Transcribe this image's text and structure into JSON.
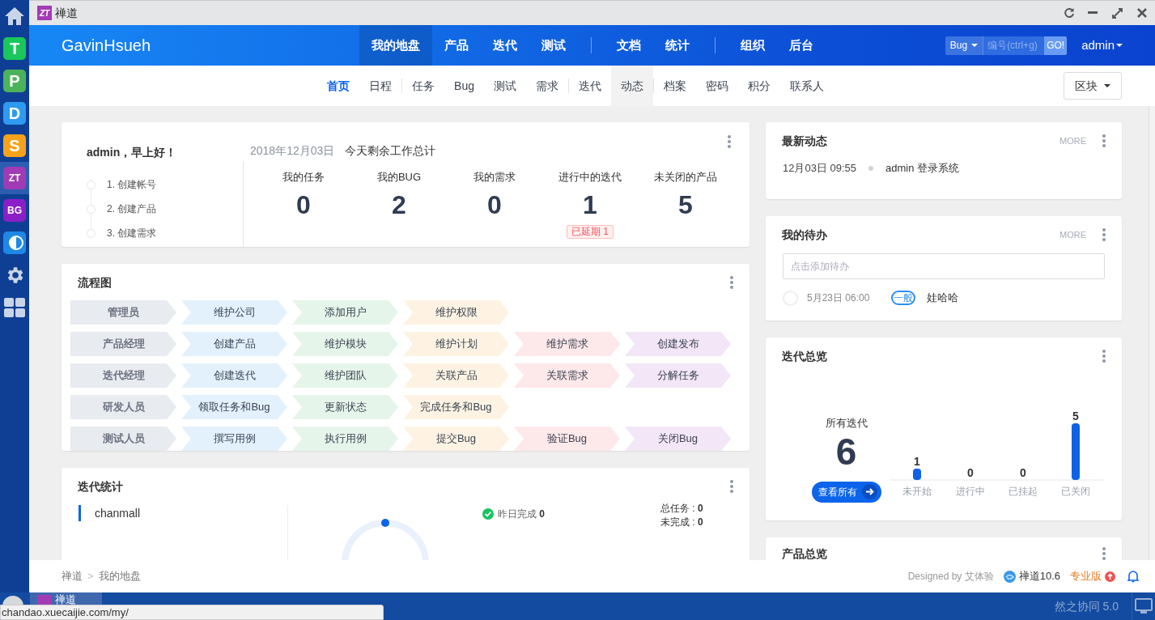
{
  "launcher": {
    "apps": [
      {
        "kind": "home",
        "selected": false
      },
      {
        "kind": "letter",
        "label": "T",
        "color": "#19c75b",
        "selected": false
      },
      {
        "kind": "letter",
        "label": "P",
        "color": "#4cb35a",
        "selected": false
      },
      {
        "kind": "letter",
        "label": "D",
        "color": "#2f9bf0",
        "selected": false
      },
      {
        "kind": "letter",
        "label": "S",
        "color": "#f7a21b",
        "selected": false
      },
      {
        "kind": "letter",
        "label": "ZT",
        "color": "#a03bb5",
        "selected": true
      },
      {
        "kind": "letter",
        "label": "BG",
        "color": "#8a1fc8",
        "selected": false
      },
      {
        "kind": "half-circle",
        "color": "#1e88e5",
        "selected": false
      },
      {
        "kind": "settings",
        "selected": false
      },
      {
        "kind": "grid",
        "selected": false
      }
    ]
  },
  "titlebar": {
    "logo": "ZT",
    "title": "禅道"
  },
  "header": {
    "brand": "GavinHsueh",
    "nav": [
      [
        {
          "label": "我的地盘",
          "selected": true
        },
        {
          "label": "产品",
          "selected": false
        },
        {
          "label": "迭代",
          "selected": false
        },
        {
          "label": "测试",
          "selected": false
        }
      ],
      [
        {
          "label": "文档",
          "selected": false
        },
        {
          "label": "统计",
          "selected": false
        }
      ],
      [
        {
          "label": "组织",
          "selected": false
        },
        {
          "label": "后台",
          "selected": false
        }
      ]
    ],
    "search": {
      "type": "Bug",
      "placeholder": "编号(ctrl+g)",
      "button": "GO!"
    },
    "user": "admin"
  },
  "subnav": {
    "groups": [
      [
        {
          "label": "首页",
          "selected": true,
          "hovered": false
        },
        {
          "label": "日程",
          "selected": false,
          "hovered": false
        }
      ],
      [
        {
          "label": "任务",
          "selected": false,
          "hovered": false
        },
        {
          "label": "Bug",
          "selected": false,
          "hovered": false
        },
        {
          "label": "测试",
          "selected": false,
          "hovered": false
        },
        {
          "label": "需求",
          "selected": false,
          "hovered": false
        }
      ],
      [
        {
          "label": "迭代",
          "selected": false,
          "hovered": false
        },
        {
          "label": "动态",
          "selected": false,
          "hovered": true
        }
      ],
      [
        {
          "label": "档案",
          "selected": false,
          "hovered": false
        },
        {
          "label": "密码",
          "selected": false,
          "hovered": false
        },
        {
          "label": "积分",
          "selected": false,
          "hovered": false
        },
        {
          "label": "联系人",
          "selected": false,
          "hovered": false
        }
      ]
    ],
    "block_button": "区块"
  },
  "welcome": {
    "greeting": "admin，早上好！",
    "steps": [
      "1. 创建帐号",
      "2. 创建产品",
      "3. 创建需求"
    ],
    "date": "2018年12月03日",
    "summary": "今天剩余工作总计",
    "stats": [
      {
        "label": "我的任务",
        "value": "0"
      },
      {
        "label": "我的BUG",
        "value": "2"
      },
      {
        "label": "我的需求",
        "value": "0"
      },
      {
        "label": "进行中的迭代",
        "value": "1",
        "badge": "已延期 1"
      },
      {
        "label": "未关闭的产品",
        "value": "5"
      }
    ]
  },
  "flowchart": {
    "title": "流程图",
    "rows": [
      {
        "role": "管理员",
        "steps": [
          {
            "label": "维护公司",
            "color": "#e3f1fd"
          },
          {
            "label": "添加用户",
            "color": "#e6f5ea"
          },
          {
            "label": "维护权限",
            "color": "#fef3e3"
          }
        ]
      },
      {
        "role": "产品经理",
        "steps": [
          {
            "label": "创建产品",
            "color": "#e3f1fd"
          },
          {
            "label": "维护模块",
            "color": "#e6f5ea"
          },
          {
            "label": "维护计划",
            "color": "#fef3e3"
          },
          {
            "label": "维护需求",
            "color": "#fde8ea"
          },
          {
            "label": "创建发布",
            "color": "#f3e6f7"
          }
        ]
      },
      {
        "role": "迭代经理",
        "steps": [
          {
            "label": "创建迭代",
            "color": "#e3f1fd"
          },
          {
            "label": "维护团队",
            "color": "#e6f5ea"
          },
          {
            "label": "关联产品",
            "color": "#fef3e3"
          },
          {
            "label": "关联需求",
            "color": "#fde8ea"
          },
          {
            "label": "分解任务",
            "color": "#f3e6f7"
          }
        ]
      },
      {
        "role": "研发人员",
        "steps": [
          {
            "label": "领取任务和Bug",
            "color": "#e3f1fd"
          },
          {
            "label": "更新状态",
            "color": "#e6f5ea"
          },
          {
            "label": "完成任务和Bug",
            "color": "#fef3e3"
          }
        ]
      },
      {
        "role": "测试人员",
        "steps": [
          {
            "label": "撰写用例",
            "color": "#e3f1fd"
          },
          {
            "label": "执行用例",
            "color": "#e6f5ea"
          },
          {
            "label": "提交Bug",
            "color": "#fef3e3"
          },
          {
            "label": "验证Bug",
            "color": "#fde8ea"
          },
          {
            "label": "关闭Bug",
            "color": "#f3e6f7"
          }
        ]
      }
    ]
  },
  "iteration_stats": {
    "title": "迭代统计",
    "projects": [
      {
        "name": "chanmall",
        "selected": true
      }
    ],
    "yesterday_label": "昨日完成",
    "yesterday_value": "0",
    "totals": [
      {
        "label": "总任务 : ",
        "value": "0"
      },
      {
        "label": "未完成 : ",
        "value": "0"
      }
    ]
  },
  "activity": {
    "title": "最新动态",
    "more": "MORE",
    "entries": [
      {
        "time": "12月03日 09:55",
        "text": "admin 登录系统"
      }
    ]
  },
  "todo": {
    "title": "我的待办",
    "more": "MORE",
    "placeholder": "点击添加待办",
    "items": [
      {
        "time": "5月23日 06:00",
        "priority": "一般",
        "text": "娃哈哈",
        "done": false
      }
    ]
  },
  "iteration_overview": {
    "title": "迭代总览",
    "all_label": "所有迭代",
    "all_value": "6",
    "view_all": "查看所有",
    "chart_data": {
      "type": "bar",
      "categories": [
        "未开始",
        "进行中",
        "已挂起",
        "已关闭"
      ],
      "values": [
        1,
        0,
        0,
        5
      ],
      "data_labels": true
    }
  },
  "product_overview": {
    "title": "产品总览"
  },
  "footer": {
    "breadcrumb": [
      "禅道",
      "我的地盘"
    ],
    "breadcrumb_separator": ">",
    "designed_by": "Designed by 艾体验",
    "version": "禅道10.6",
    "edition": "专业版"
  },
  "taskbar": {
    "app": "禅道",
    "url": "chandao.xuecaijie.com/my/",
    "product": "然之协同 5.0"
  }
}
